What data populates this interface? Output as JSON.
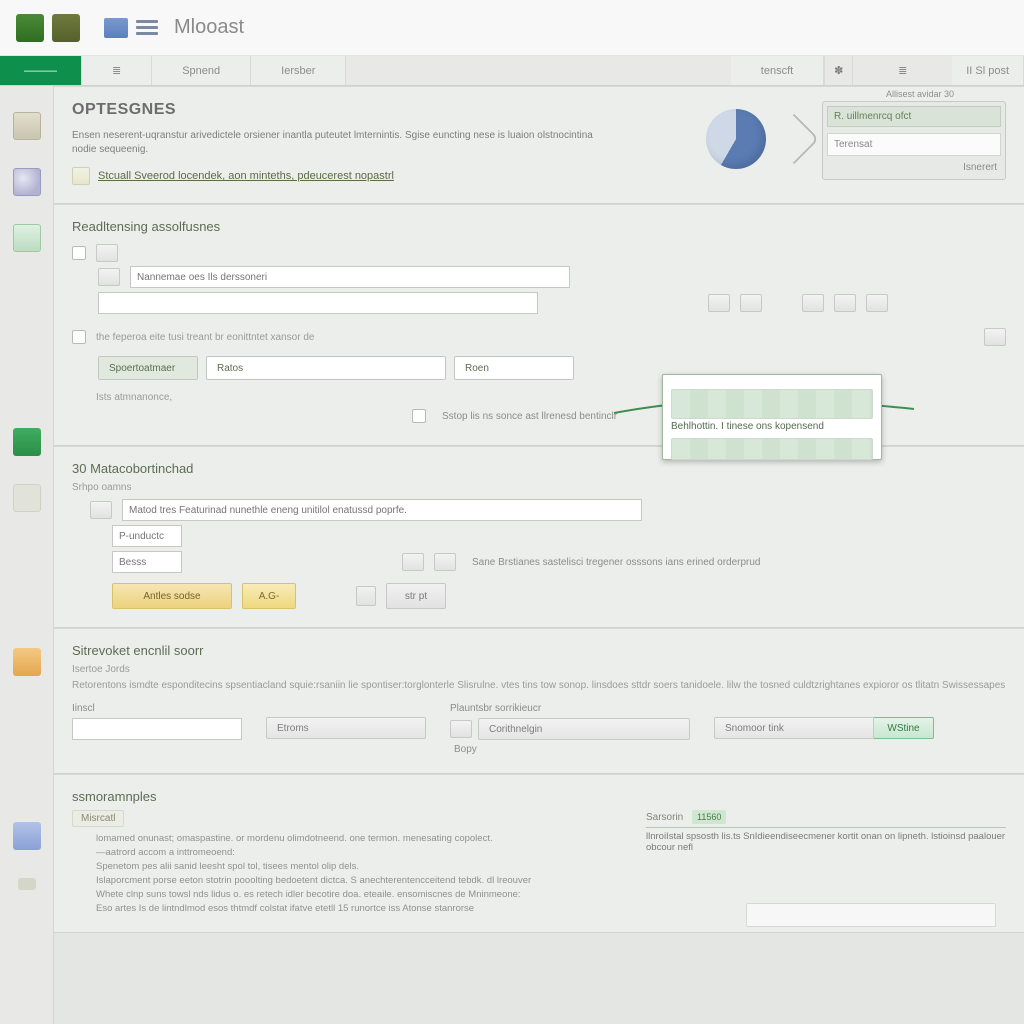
{
  "titlebar": {
    "app_name": "Mlooast"
  },
  "ribbon": {
    "tab_active": "———",
    "tab_b_icon": "≣",
    "tab_c": "Spnend",
    "tab_d": "Iersber",
    "tab_r1": "tenscft",
    "tab_r2_icon": "✽",
    "minibox": "≣",
    "tab_r3": "II Sl post",
    "hint": "Allisest avidar 30"
  },
  "optsSection": {
    "title": "OPTESGNES",
    "desc": "Ensen neserent-uqranstur arivedictele orsiener inantla puteutet lmternintis. Sgise euncting nese is luaion olstnocintina nodie sequeenig.",
    "link": "Stcuall Sveerod locendek, aon minteths, pdeucerest nopastrl",
    "info_row1": "R.  uillmenrcq ofct",
    "info_row2": "Terensat",
    "info_caption": "Isnerert"
  },
  "sec1": {
    "title": "Readltensing assolfusnes",
    "placeholder1": "Nannemae oes Ils derssoneri",
    "hint_above_pills": "the feperoa eite tusi treant br eonittntet xansor de",
    "pill_a": "Spoertoatmaer",
    "pill_b": "Ratos",
    "pill_c": "Roen",
    "bottom_hint": "Ists atmnanonce,",
    "check_hint": "Sstop lis ns sonce ast llrenesd bentinclr"
  },
  "callout": {
    "text": "Behlhottin. I tinese ons kopensend"
  },
  "sec2": {
    "title": "30 Matacobortinchad",
    "subtitle": "Srhpo oamns",
    "placeholder": "Matod tres Featurinad nunethle eneng unitilol enatussd poprfe.",
    "tinyinput": "P-unductc",
    "tinyinput2": "Besss",
    "checkline": "Sane Brstianes sastelisci tregener osssons ians erined orderprud",
    "btn_a": "Antles sodse",
    "btn_b": "A.G-",
    "btn_c": "str pt"
  },
  "sec3": {
    "title": "Sitrevoket encnlil soorr",
    "subtitle": "Isertoe Jords",
    "desc": "Retorentons ismdte esponditecins spsentiacland squie:rsaniin lie spontiser:torglonterle Slisrulne. vtes tins tow sonop. linsdoes sttdr soers tanidoele. lilw the tosned culdtzrightanes expioror os tlitatn Swissessapes",
    "left_label": "Iinscl",
    "mid_label": "Plauntsbr sorrikieucr",
    "btn_left": "Etroms",
    "btn_mid": "Corithnelgin",
    "btn_mid_icon": "»",
    "btn_right_a": "Snomoor tink",
    "btn_right_b": "WStine",
    "tiny": "Bopy"
  },
  "sec4": {
    "title": "ssmoramnples",
    "tag": "Misrcatl",
    "bullets": [
      "lomamed onunast; omaspastine. or mordenu olimdotneend. one termon. menesating copolect.",
      "—aatrord accom a inttromeoend:",
      "Spenetom pes alii sanid leesht spol tol, tisees mentol olip dels.",
      "Islaporcment porse eeton stotrin pooolting bedoetent dictca. S anechterentencceitend tebdk. dl lreouver",
      "Whete clnp suns towsl nds lidus o. es retech idler becotire doa. eteaile. ensomiscnes de Mninmeone:",
      "Eso artes Is de lintndlmod esos thtmdf colstat ifatve etetll 15 runortce iss Atonse stanrorse"
    ],
    "right_header": "Sarsorin",
    "right_code": "11560",
    "right_line": "llnroiIstal spsosth lis.ts SnIdieendiseecmener kortit onan on lipneth. lstioinsd paalouer obcour nefl"
  }
}
